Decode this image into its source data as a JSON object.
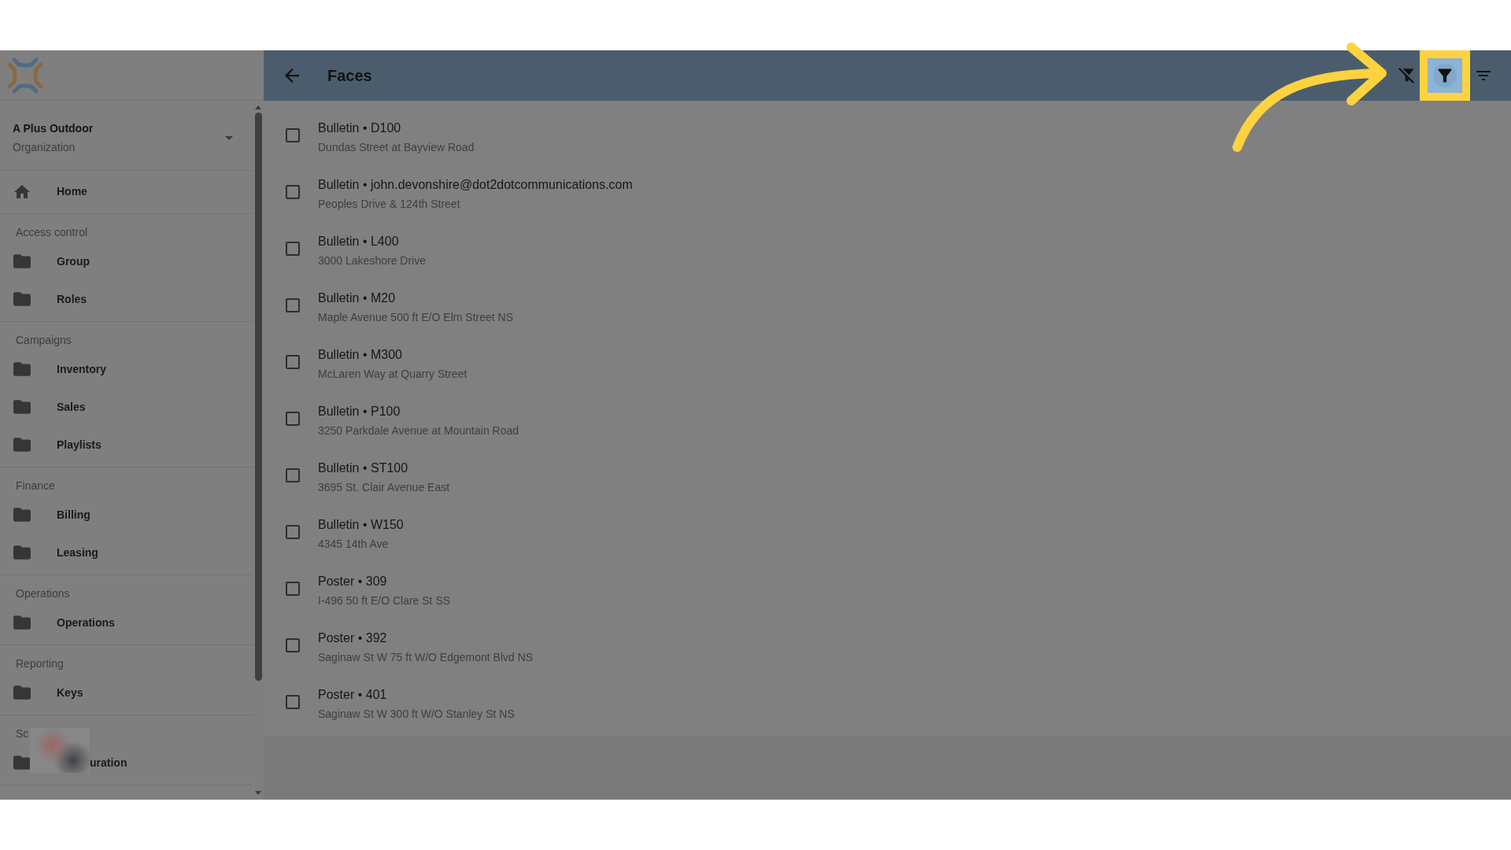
{
  "sidebar": {
    "organization": {
      "name": "A Plus Outdoor",
      "subtitle": "Organization"
    },
    "sections": [
      {
        "obscured": false,
        "items": [
          {
            "label": "Home"
          }
        ]
      },
      {
        "title": "Access control",
        "obscured": false,
        "items": [
          {
            "label": "Group"
          },
          {
            "label": "Roles"
          }
        ]
      },
      {
        "title": "Campaigns",
        "obscured": false,
        "items": [
          {
            "label": "Inventory"
          },
          {
            "label": "Sales"
          },
          {
            "label": "Playlists"
          }
        ]
      },
      {
        "title": "Finance",
        "obscured": false,
        "items": [
          {
            "label": "Billing"
          },
          {
            "label": "Leasing"
          }
        ]
      },
      {
        "title": "Operations",
        "obscured": false,
        "items": [
          {
            "label": "Operations"
          }
        ]
      },
      {
        "title": "Reporting",
        "obscured": false,
        "items": [
          {
            "label": "Keys"
          }
        ]
      },
      {
        "title": "Sc",
        "obscured": true,
        "items": [
          {
            "label": "uration"
          }
        ]
      }
    ]
  },
  "header": {
    "title": "Faces",
    "actions": [
      {
        "kind": "filter-off",
        "highlighted": false
      },
      {
        "kind": "filter",
        "highlighted": true
      },
      {
        "kind": "sort",
        "highlighted": false
      }
    ]
  },
  "rows": [
    {
      "title": "Bulletin • D100",
      "subtitle": "Dundas Street at Bayview Road",
      "checked": false
    },
    {
      "title": "Bulletin • john.devonshire@dot2dotcommunications.com",
      "subtitle": "Peoples Drive & 124th Street",
      "checked": false
    },
    {
      "title": "Bulletin • L400",
      "subtitle": "3000 Lakeshore Drive",
      "checked": false
    },
    {
      "title": "Bulletin • M20",
      "subtitle": "Maple Avenue 500 ft E/O Elm Street NS",
      "checked": false
    },
    {
      "title": "Bulletin • M300",
      "subtitle": "McLaren Way at Quarry Street",
      "checked": false
    },
    {
      "title": "Bulletin • P100",
      "subtitle": "3250 Parkdale Avenue at Mountain Road",
      "checked": false
    },
    {
      "title": "Bulletin • ST100",
      "subtitle": "3695 St. Clair Avenue East",
      "checked": false
    },
    {
      "title": "Bulletin • W150",
      "subtitle": "4345 14th Ave",
      "checked": false
    },
    {
      "title": "Poster • 309",
      "subtitle": "I-496 50 ft E/O Clare St SS",
      "checked": false
    },
    {
      "title": "Poster • 392",
      "subtitle": "Saginaw St W 75 ft W/O Edgemont Blvd NS",
      "checked": false
    },
    {
      "title": "Poster • 401",
      "subtitle": "Saginaw St W 300 ft W/O Stanley St NS",
      "checked": false
    }
  ]
}
